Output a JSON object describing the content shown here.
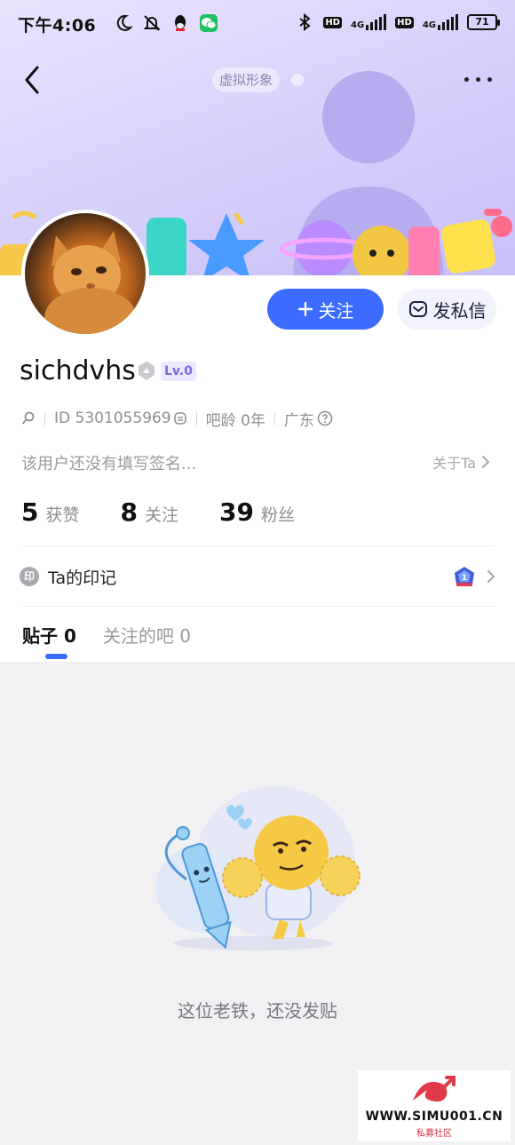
{
  "status_bar": {
    "time": "下午4:06",
    "net1": "4G",
    "net2": "4G",
    "hd": "HD",
    "battery": "71"
  },
  "header": {
    "virtual_chip": "虚拟形象"
  },
  "profile": {
    "username": "sichdvhs",
    "level": "Lv.0",
    "id_text": "ID 5301055969",
    "age_text": "吧龄 0年",
    "region": "广东",
    "signature": "该用户还没有填写签名...",
    "about_label": "关于Ta"
  },
  "actions": {
    "follow_label": "关注",
    "message_label": "发私信"
  },
  "stats": [
    {
      "num": "5",
      "label": "获赞"
    },
    {
      "num": "8",
      "label": "关注"
    },
    {
      "num": "39",
      "label": "粉丝"
    }
  ],
  "marks": {
    "icon_text": "印",
    "label": "Ta的印记"
  },
  "tabs": [
    {
      "label": "贴子 0",
      "active": true
    },
    {
      "label": "关注的吧 0",
      "active": false
    }
  ],
  "empty": {
    "message": "这位老铁，还没发贴"
  },
  "watermark": {
    "text": "WWW.SIMU001.CN",
    "sub": "私募社区"
  },
  "colors": {
    "accent": "#3b6bff",
    "banner": "#d9d2fb"
  }
}
